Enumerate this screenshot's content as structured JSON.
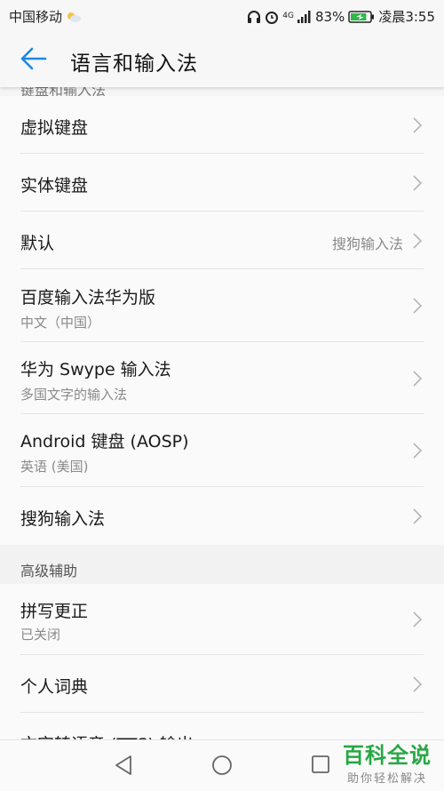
{
  "status_bar": {
    "carrier": "中国移动",
    "network": "4G",
    "battery": "83%",
    "time": "凌晨3:55",
    "battery_level": 0.83
  },
  "app_bar": {
    "title": "语言和输入法"
  },
  "top_header_clipped": "键盘和输入法",
  "keyboard_items": [
    {
      "title": "虚拟键盘"
    },
    {
      "title": "实体键盘"
    },
    {
      "title": "默认",
      "value": "搜狗输入法"
    },
    {
      "title": "百度输入法华为版",
      "subtitle": "中文（中国）"
    },
    {
      "title": "华为 Swype 输入法",
      "subtitle": "多国文字的输入法"
    },
    {
      "title": "Android 键盘 (AOSP)",
      "subtitle": "英语 (美国)"
    },
    {
      "title": "搜狗输入法"
    }
  ],
  "advanced_section": {
    "label": "高级辅助",
    "items": [
      {
        "title": "拼写更正",
        "subtitle": "已关闭"
      },
      {
        "title": "个人词典"
      },
      {
        "title": "文字转语音 (TTS) 输出"
      }
    ]
  },
  "watermark": {
    "line1": "百科全说",
    "line2": "助你轻松解决"
  },
  "colors": {
    "accent": "#1e88e5",
    "watermark_green": "#27a844"
  }
}
